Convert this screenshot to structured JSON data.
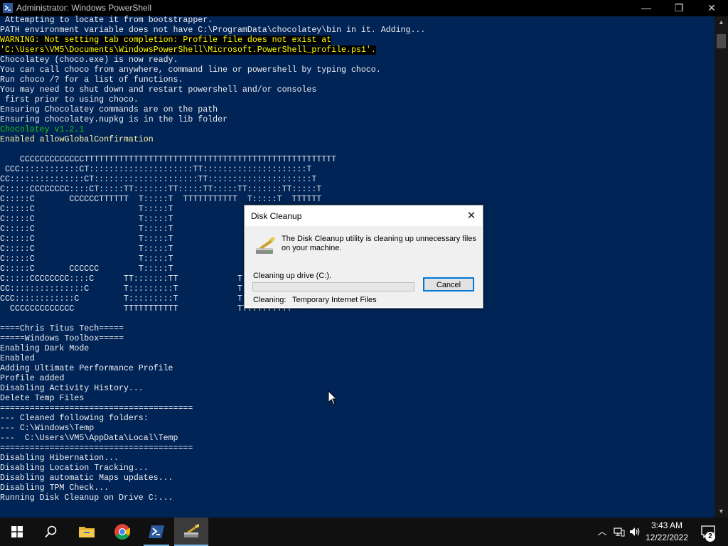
{
  "window": {
    "title": "Administrator: Windows PowerShell",
    "controls": {
      "minimize": "—",
      "maximize": "❐",
      "close": "✕"
    }
  },
  "console": {
    "lines": [
      {
        "text": " Attempting to locate it from bootstrapper.",
        "style": "normal"
      },
      {
        "text": "PATH environment variable does not have C:\\ProgramData\\chocolatey\\bin in it. Adding...",
        "style": "normal"
      },
      {
        "text": "WARNING: Not setting tab completion: Profile file does not exist at",
        "style": "warn"
      },
      {
        "text": "'C:\\Users\\VM5\\Documents\\WindowsPowerShell\\Microsoft.PowerShell_profile.ps1'.",
        "style": "warn"
      },
      {
        "text": "Chocolatey (choco.exe) is now ready.",
        "style": "normal"
      },
      {
        "text": "You can call choco from anywhere, command line or powershell by typing choco.",
        "style": "normal"
      },
      {
        "text": "Run choco /? for a list of functions.",
        "style": "normal"
      },
      {
        "text": "You may need to shut down and restart powershell and/or consoles",
        "style": "normal"
      },
      {
        "text": " first prior to using choco.",
        "style": "normal"
      },
      {
        "text": "Ensuring Chocolatey commands are on the path",
        "style": "normal"
      },
      {
        "text": "Ensuring chocolatey.nupkg is in the lib folder",
        "style": "normal"
      },
      {
        "text": "Chocolatey v1.2.1",
        "style": "green"
      },
      {
        "text": "Enabled allowGlobalConfirmation",
        "style": "yellow"
      },
      {
        "text": "",
        "style": "normal"
      },
      {
        "text": "    CCCCCCCCCCCCCTTTTTTTTTTTTTTTTTTTTTTTTTTTTTTTTTTTTTTTTTTTTTTTTTTT",
        "style": "normal"
      },
      {
        "text": " CCC::::::::::::CT:::::::::::::::::::::TT:::::::::::::::::::::T",
        "style": "normal"
      },
      {
        "text": "CC:::::::::::::::CT:::::::::::::::::::::TT:::::::::::::::::::::T",
        "style": "normal"
      },
      {
        "text": "C:::::CCCCCCCC::::CT:::::TT:::::::TT:::::TT:::::TT:::::::TT:::::T",
        "style": "normal"
      },
      {
        "text": "C:::::C       CCCCCCTTTTTT  T:::::T  TTTTTTTTTTT  T:::::T  TTTTTT",
        "style": "normal"
      },
      {
        "text": "C:::::C                     T:::::T",
        "style": "normal"
      },
      {
        "text": "C:::::C                     T:::::T",
        "style": "normal"
      },
      {
        "text": "C:::::C                     T:::::T",
        "style": "normal"
      },
      {
        "text": "C:::::C                     T:::::T",
        "style": "normal"
      },
      {
        "text": "C:::::C                     T:::::T",
        "style": "normal"
      },
      {
        "text": "C:::::C                     T:::::T",
        "style": "normal"
      },
      {
        "text": "C:::::C       CCCCCC        T:::::T",
        "style": "normal"
      },
      {
        "text": "C:::::CCCCCCCC::::C      TT:::::::TT            T",
        "style": "normal"
      },
      {
        "text": "CC:::::::::::::::C       T:::::::::T            T",
        "style": "normal"
      },
      {
        "text": "CCC::::::::::::C         T:::::::::T            T",
        "style": "normal"
      },
      {
        "text": "  CCCCCCCCCCCCC          TTTTTTTTTTT            TTTTTTTTTTT",
        "style": "normal"
      },
      {
        "text": "",
        "style": "normal"
      },
      {
        "text": "====Chris Titus Tech=====",
        "style": "normal"
      },
      {
        "text": "=====Windows Toolbox=====",
        "style": "normal"
      },
      {
        "text": "Enabling Dark Mode",
        "style": "normal"
      },
      {
        "text": "Enabled",
        "style": "normal"
      },
      {
        "text": "Adding Ultimate Performance Profile",
        "style": "normal"
      },
      {
        "text": "Profile added",
        "style": "normal"
      },
      {
        "text": "Disabling Activity History...",
        "style": "normal"
      },
      {
        "text": "Delete Temp Files",
        "style": "normal"
      },
      {
        "text": "=======================================",
        "style": "normal"
      },
      {
        "text": "--- Cleaned following folders:",
        "style": "normal"
      },
      {
        "text": "--- C:\\Windows\\Temp",
        "style": "normal"
      },
      {
        "text": "---  C:\\Users\\VM5\\AppData\\Local\\Temp",
        "style": "normal"
      },
      {
        "text": "=======================================",
        "style": "normal"
      },
      {
        "text": "Disabling Hibernation...",
        "style": "normal"
      },
      {
        "text": "Disabling Location Tracking...",
        "style": "normal"
      },
      {
        "text": "Disabling automatic Maps updates...",
        "style": "normal"
      },
      {
        "text": "Disabling TPM Check...",
        "style": "normal"
      },
      {
        "text": "Running Disk Cleanup on Drive C:...",
        "style": "normal"
      }
    ]
  },
  "dialog": {
    "title": "Disk Cleanup",
    "close": "✕",
    "message": "The Disk Cleanup utility is cleaning up unnecessary files on your machine.",
    "drive_text": "Cleaning up drive  (C:).",
    "progress": 0,
    "cancel_label": "Cancel",
    "cleaning_label": "Cleaning:",
    "cleaning_value": "Temporary Internet Files"
  },
  "taskbar": {
    "apps": [
      "start-icon",
      "search-icon",
      "file-explorer-icon",
      "chrome-icon",
      "powershell-icon",
      "disk-cleanup-icon"
    ],
    "clock_time": "3:43 AM",
    "clock_date": "12/22/2022",
    "notification_count": "2"
  }
}
